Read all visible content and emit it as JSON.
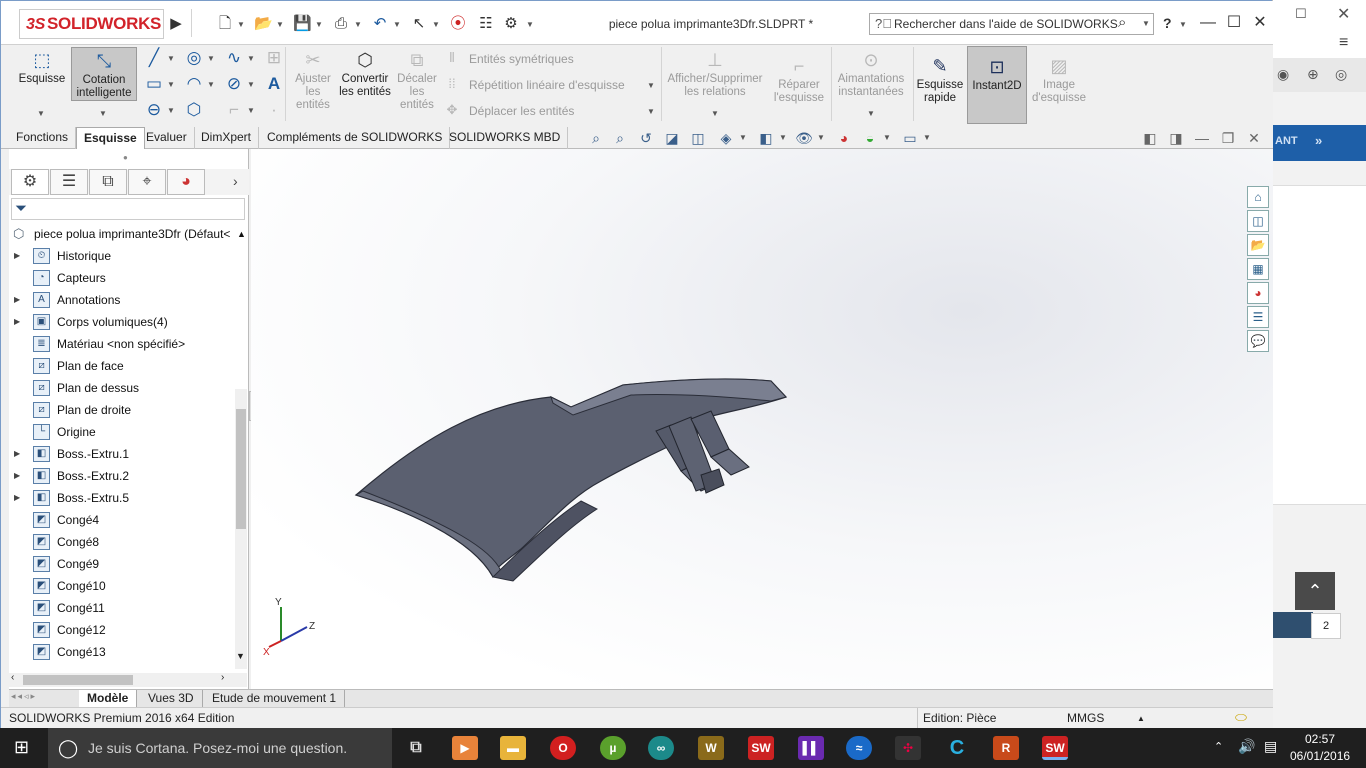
{
  "app": {
    "logo_text": "SOLIDWORKS",
    "logo_mark": "3S",
    "document_title": "piece polua imprimante3Dfr.SLDPRT *",
    "search_placeholder": "Rechercher dans l'aide de SOLIDWORKS",
    "help_label": "?"
  },
  "command_manager": {
    "esquisse": "Esquisse",
    "cotation": "Cotation intelligente",
    "ajuster": "Ajuster les entités",
    "convertir": "Convertir les entités",
    "decaler": "Décaler les entités",
    "entites_sym": "Entités symétriques",
    "repetition": "Répétition linéaire d'esquisse",
    "deplacer": "Déplacer les entités",
    "afficher_rel": "Afficher/Supprimer les relations",
    "reparer": "Réparer l'esquisse",
    "aimantations": "Aimantations instantanées",
    "esquisse_rapide": "Esquisse rapide",
    "instant2d": "Instant2D",
    "image_esquisse": "Image d'esquisse"
  },
  "tabs": [
    "Fonctions",
    "Esquisse",
    "Evaluer",
    "DimXpert",
    "Compléments de SOLIDWORKS",
    "SOLIDWORKS MBD"
  ],
  "active_tab": "Esquisse",
  "feature_tree": {
    "root": "piece polua imprimante3Dfr  (Défaut<",
    "items": [
      {
        "label": "Historique",
        "expand": true,
        "icon": "history-icon",
        "glyph": "⏲"
      },
      {
        "label": "Capteurs",
        "expand": false,
        "icon": "sensor-icon",
        "glyph": "◔"
      },
      {
        "label": "Annotations",
        "expand": true,
        "icon": "annotation-icon",
        "glyph": "A"
      },
      {
        "label": "Corps volumiques(4)",
        "expand": true,
        "icon": "solid-bodies-icon",
        "glyph": "▣"
      },
      {
        "label": "Matériau <non spécifié>",
        "expand": false,
        "icon": "material-icon",
        "glyph": "≣"
      },
      {
        "label": "Plan de face",
        "expand": false,
        "icon": "plane-icon",
        "glyph": "⧄"
      },
      {
        "label": "Plan de dessus",
        "expand": false,
        "icon": "plane-icon",
        "glyph": "⧄"
      },
      {
        "label": "Plan de droite",
        "expand": false,
        "icon": "plane-icon",
        "glyph": "⧄"
      },
      {
        "label": "Origine",
        "expand": false,
        "icon": "origin-icon",
        "glyph": "└"
      },
      {
        "label": "Boss.-Extru.1",
        "expand": true,
        "icon": "extrude-icon",
        "glyph": "◧"
      },
      {
        "label": "Boss.-Extru.2",
        "expand": true,
        "icon": "extrude-icon",
        "glyph": "◧"
      },
      {
        "label": "Boss.-Extru.5",
        "expand": true,
        "icon": "extrude-icon",
        "glyph": "◧"
      },
      {
        "label": "Congé4",
        "expand": false,
        "icon": "fillet-icon",
        "glyph": "◩"
      },
      {
        "label": "Congé8",
        "expand": false,
        "icon": "fillet-icon",
        "glyph": "◩"
      },
      {
        "label": "Congé9",
        "expand": false,
        "icon": "fillet-icon",
        "glyph": "◩"
      },
      {
        "label": "Congé10",
        "expand": false,
        "icon": "fillet-icon",
        "glyph": "◩"
      },
      {
        "label": "Congé11",
        "expand": false,
        "icon": "fillet-icon",
        "glyph": "◩"
      },
      {
        "label": "Congé12",
        "expand": false,
        "icon": "fillet-icon",
        "glyph": "◩"
      },
      {
        "label": "Congé13",
        "expand": false,
        "icon": "fillet-icon",
        "glyph": "◩"
      }
    ]
  },
  "bottom_tabs": [
    "Modèle",
    "Vues 3D",
    "Etude de mouvement 1"
  ],
  "status": {
    "edition_product": "SOLIDWORKS Premium 2016 x64 Edition",
    "edition_mode": "Edition: Pièce",
    "units": "MMGS"
  },
  "triad": {
    "x": "X",
    "y": "Y",
    "z": "Z"
  },
  "taskbar": {
    "cortana": "Je suis Cortana. Posez-moi une question.",
    "time": "02:57",
    "date": "06/01/2016"
  },
  "browser_bg": {
    "badge": "2",
    "banner_text": "ANT"
  },
  "colors": {
    "accent": "#1c5a9e",
    "logo_red": "#d2232a",
    "part_fill": "#5a5f70",
    "part_edge": "#2a2d38"
  }
}
